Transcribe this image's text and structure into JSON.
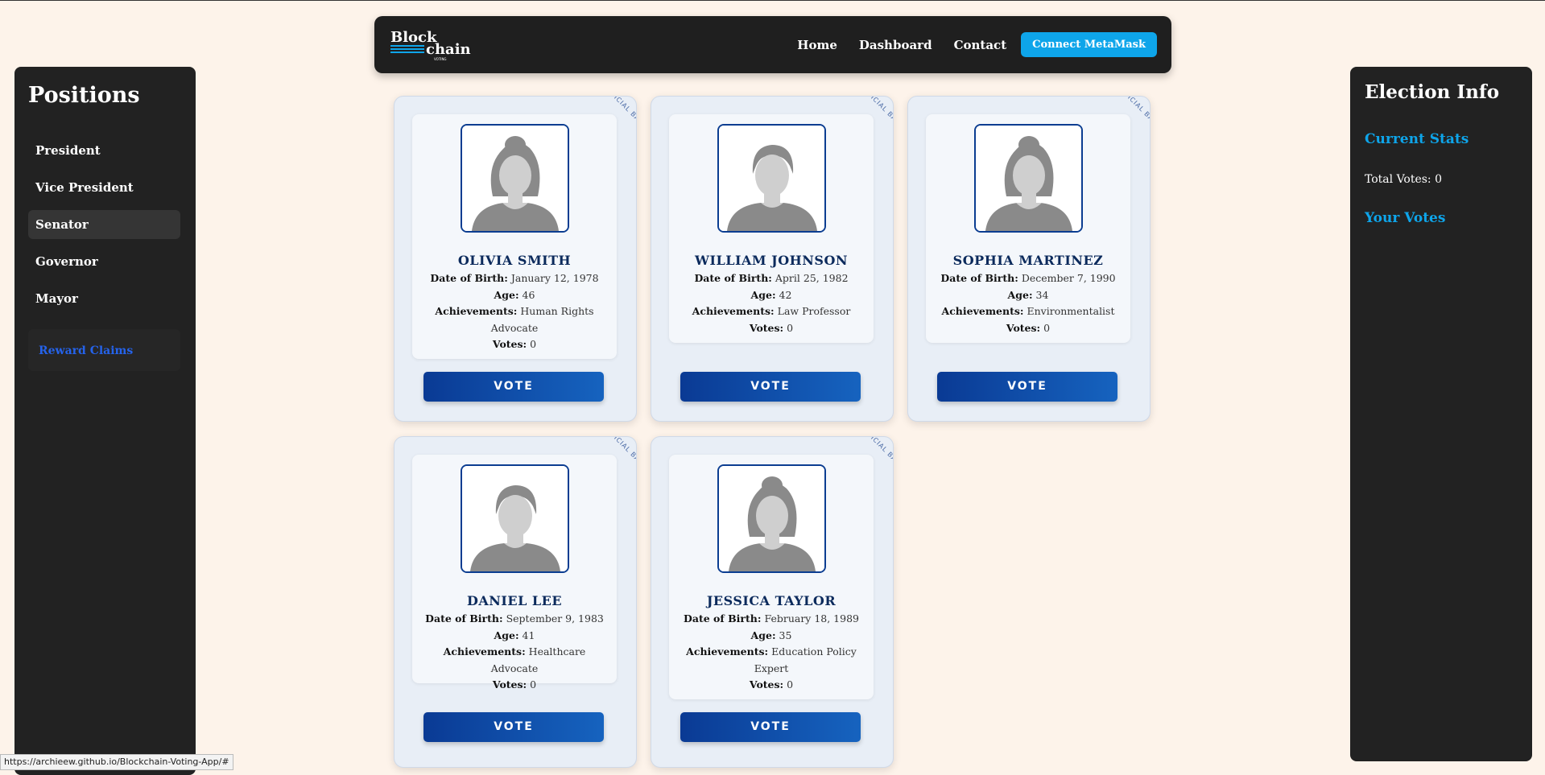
{
  "nav": {
    "logo_line1": "Block",
    "logo_line2": "chain",
    "logo_sub": "VOTING",
    "links": [
      "Home",
      "Dashboard",
      "Contact"
    ],
    "connect_label": "Connect MetaMask"
  },
  "sidebar": {
    "title": "Positions",
    "items": [
      {
        "label": "President"
      },
      {
        "label": "Vice President"
      },
      {
        "label": "Senator",
        "active": true
      },
      {
        "label": "Governor"
      },
      {
        "label": "Mayor"
      }
    ],
    "reward_label": "Reward Claims"
  },
  "election_info": {
    "title": "Election Info",
    "current_stats": "Current Stats",
    "total_votes": "Total Votes: 0",
    "your_votes": "Your Votes"
  },
  "ribbon_text": "ICIAL BA",
  "labels": {
    "dob": "Date of Birth:",
    "age": "Age:",
    "achievements": "Achievements:",
    "votes": "Votes:",
    "vote_button": "VOTE"
  },
  "candidates": [
    {
      "name": "OLIVIA SMITH",
      "dob": "January 12, 1978",
      "age": "46",
      "achievements_line1": "Human Rights",
      "achievements_line2": "Advocate",
      "votes": "0",
      "gender": "female"
    },
    {
      "name": "WILLIAM JOHNSON",
      "dob": "April 25, 1982",
      "age": "42",
      "achievements_line1": "Law Professor",
      "achievements_line2": "",
      "votes": "0",
      "gender": "male"
    },
    {
      "name": "SOPHIA MARTINEZ",
      "dob": "December 7, 1990",
      "age": "34",
      "achievements_line1": "Environmentalist",
      "achievements_line2": "",
      "votes": "0",
      "gender": "female"
    },
    {
      "name": "DANIEL LEE",
      "dob": "September 9, 1983",
      "age": "41",
      "achievements_line1": "Healthcare Advocate",
      "achievements_line2": "",
      "votes": "0",
      "gender": "male"
    },
    {
      "name": "JESSICA TAYLOR",
      "dob": "February 18, 1989",
      "age": "35",
      "achievements_line1": "Education Policy",
      "achievements_line2": "Expert",
      "votes": "0",
      "gender": "female"
    }
  ],
  "status_url": "https://archieew.github.io/Blockchain-Voting-App/#"
}
